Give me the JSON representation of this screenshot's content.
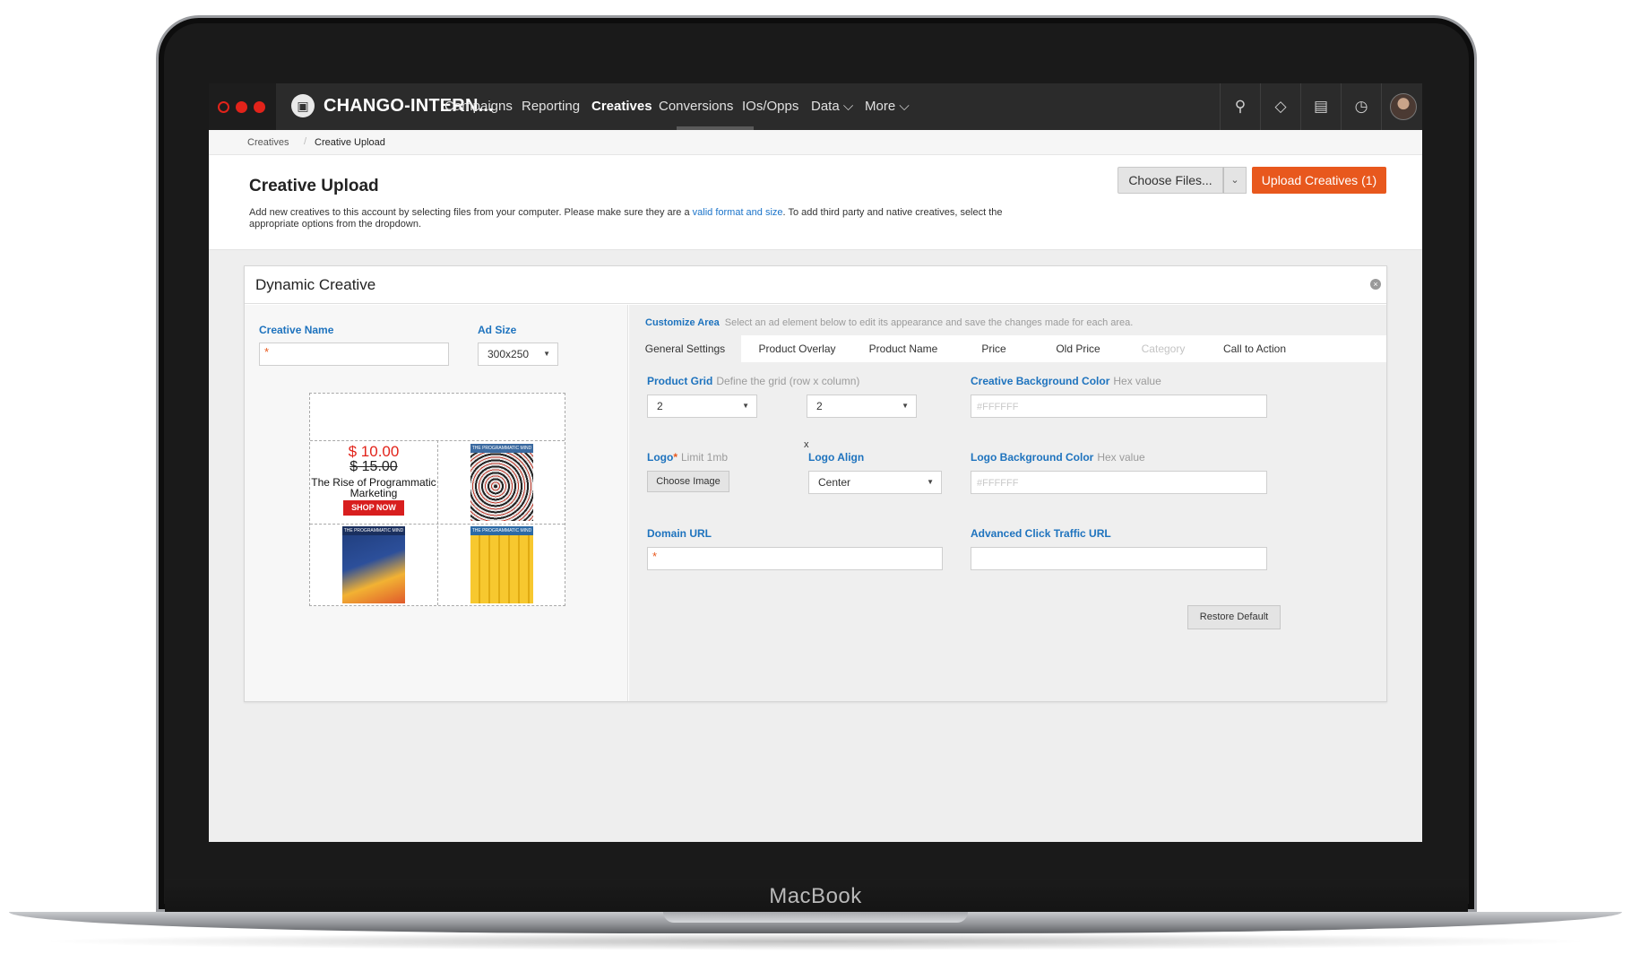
{
  "device": {
    "brand": "MacBook"
  },
  "nav": {
    "org_name": "CHANGO-INTERN...",
    "items": [
      {
        "label": "Campaigns"
      },
      {
        "label": "Reporting"
      },
      {
        "label": "Creatives"
      },
      {
        "label": "Conversions"
      },
      {
        "label": "IOs/Opps"
      },
      {
        "label": "Data ⌵"
      },
      {
        "label": "More ⌵"
      }
    ],
    "active": "Creatives",
    "icons": [
      "search-icon",
      "tag-icon",
      "clipboard-icon",
      "clock-icon",
      "avatar"
    ],
    "accent": "#e2231a"
  },
  "breadcrumb": {
    "items": [
      "Creatives",
      "Creative Upload"
    ]
  },
  "header": {
    "title": "Creative Upload",
    "desc_pre": "Add new creatives to this account by selecting files from your computer. Please make sure they are a ",
    "desc_link": "valid format and size",
    "desc_post": ". To add third party and native creatives, select the appropriate options from the dropdown.",
    "choose_files": "Choose Files...",
    "upload": "Upload Creatives (1)",
    "upload_color": "#e8581d"
  },
  "panel": {
    "title": "Dynamic Creative",
    "creative_name_label": "Creative Name",
    "creative_name_value": "",
    "ad_size_label": "Ad Size",
    "ad_size_value": "300x250",
    "preview": {
      "price_new": "$ 10.00",
      "price_old": "$ 15.00",
      "product_title": "The Rise of Programmatic Marketing",
      "cta": "SHOP NOW",
      "books": [
        {
          "head": "THE PROGRAMMATIC MIND"
        },
        {
          "head": "THE PROGRAMMATIC MIND"
        },
        {
          "head": "THE PROGRAMMATIC MIND"
        }
      ]
    },
    "customize": {
      "title": "Customize Area",
      "desc": "Select an ad element below to edit its appearance and save the changes made for each area.",
      "tabs": [
        {
          "label": "General Settings",
          "state": "active"
        },
        {
          "label": "Product Overlay",
          "state": "normal"
        },
        {
          "label": "Product Name",
          "state": "normal"
        },
        {
          "label": "Price",
          "state": "normal"
        },
        {
          "label": "Old Price",
          "state": "normal"
        },
        {
          "label": "Category",
          "state": "disabled"
        },
        {
          "label": "Call to Action",
          "state": "normal"
        }
      ],
      "product_grid_label": "Product Grid",
      "product_grid_hint": "Define the grid (row x column)",
      "grid_rows": "2",
      "grid_x": "x",
      "grid_cols": "2",
      "bg_color_label": "Creative Background Color",
      "bg_color_hint": "Hex value",
      "bg_color_placeholder": "#FFFFFF",
      "logo_label": "Logo",
      "logo_hint": "Limit 1mb",
      "choose_image": "Choose Image",
      "logo_align_label": "Logo Align",
      "logo_align_value": "Center",
      "logo_bg_label": "Logo Background Color",
      "logo_bg_hint": "Hex value",
      "logo_bg_placeholder": "#FFFFFF",
      "domain_url_label": "Domain URL",
      "domain_url_value": "",
      "adv_click_label": "Advanced Click Traffic URL",
      "adv_click_value": "",
      "restore_default": "Restore Default"
    }
  }
}
